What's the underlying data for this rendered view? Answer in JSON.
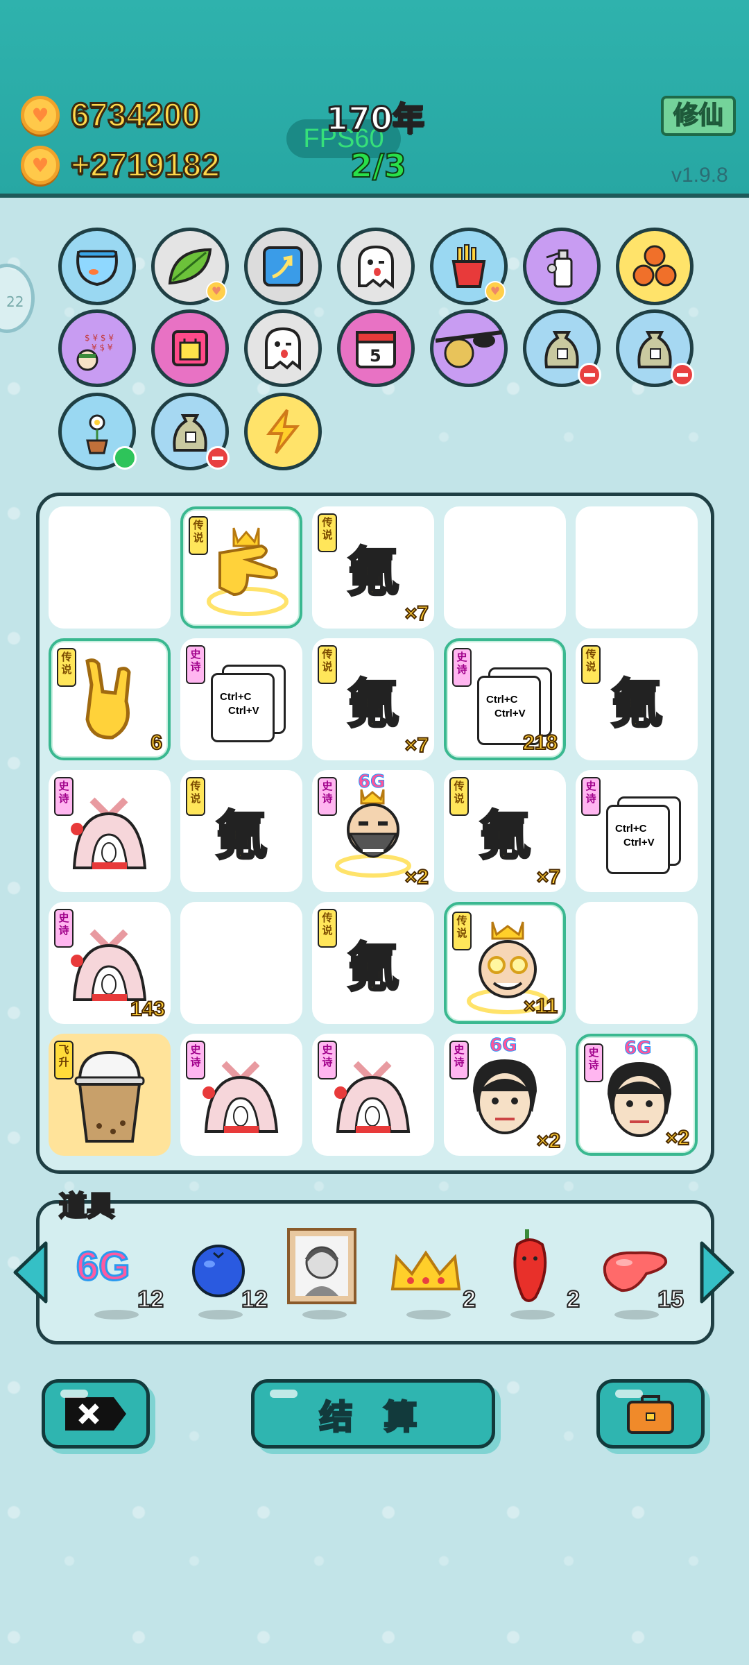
{
  "header": {
    "coins": "6734200",
    "income": "+2719182",
    "year": "170年",
    "fps": "FPS60",
    "counter": "2/3",
    "mode_button": "修仙",
    "version": "v1.9.8"
  },
  "side_tab": {
    "label": "22"
  },
  "skills": [
    {
      "name": "fishbowl-icon"
    },
    {
      "name": "leaf-icon"
    },
    {
      "name": "arrow-up-icon"
    },
    {
      "name": "ghost-icon"
    },
    {
      "name": "fries-icon"
    },
    {
      "name": "sprayer-icon"
    },
    {
      "name": "basketballs-icon"
    },
    {
      "name": "money-face-icon"
    },
    {
      "name": "bag-icon"
    },
    {
      "name": "ghost-icon-2"
    },
    {
      "name": "calendar-icon",
      "text": "5"
    },
    {
      "name": "sunglasses-icon"
    },
    {
      "name": "sack-icon"
    },
    {
      "name": "sack-icon-2"
    },
    {
      "name": "plant-icon"
    },
    {
      "name": "sack-icon-3"
    },
    {
      "name": "lightning-icon"
    }
  ],
  "board": {
    "cells": [
      {
        "empty": true
      },
      {
        "tag": "传说",
        "tag_type": "legend",
        "item": "hand-crown",
        "hl": true
      },
      {
        "tag": "传说",
        "tag_type": "legend",
        "item": "char",
        "char": "氪",
        "count": "×7"
      },
      {
        "empty": true
      },
      {
        "empty": true
      },
      {
        "tag": "传说",
        "tag_type": "legend",
        "item": "rock-hand",
        "count": "6",
        "hl": true
      },
      {
        "tag": "史诗",
        "tag_type": "epic",
        "item": "ctrl",
        "ctrl1": "Ctrl+C",
        "ctrl2": "Ctrl+V"
      },
      {
        "tag": "传说",
        "tag_type": "legend",
        "item": "char",
        "char": "氪",
        "count": "×7"
      },
      {
        "tag": "史诗",
        "tag_type": "epic",
        "item": "ctrl",
        "ctrl1": "Ctrl+C",
        "ctrl2": "Ctrl+V",
        "count": "218",
        "hl": true
      },
      {
        "tag": "传说",
        "tag_type": "legend",
        "item": "char",
        "char": "氪"
      },
      {
        "tag": "史诗",
        "tag_type": "epic",
        "item": "tent"
      },
      {
        "tag": "传说",
        "tag_type": "legend",
        "item": "char",
        "char": "氪"
      },
      {
        "tag": "史诗",
        "tag_type": "epic",
        "item": "bald-crown",
        "sixg": "6G",
        "count": "×2"
      },
      {
        "tag": "传说",
        "tag_type": "legend",
        "item": "char",
        "char": "氪",
        "count": "×7"
      },
      {
        "tag": "史诗",
        "tag_type": "epic",
        "item": "ctrl",
        "ctrl1": "Ctrl+C",
        "ctrl2": "Ctrl+V"
      },
      {
        "tag": "史诗",
        "tag_type": "epic",
        "item": "tent",
        "count": "143"
      },
      {
        "empty": true
      },
      {
        "tag": "传说",
        "tag_type": "legend",
        "item": "char",
        "char": "氪"
      },
      {
        "tag": "传说",
        "tag_type": "legend",
        "item": "king-face",
        "count": "×11",
        "hl": true
      },
      {
        "empty": true
      },
      {
        "tag": "飞升",
        "tag_type": "fly",
        "item": "cup",
        "gold": true
      },
      {
        "tag": "史诗",
        "tag_type": "epic",
        "item": "tent"
      },
      {
        "tag": "史诗",
        "tag_type": "epic",
        "item": "tent"
      },
      {
        "tag": "史诗",
        "tag_type": "epic",
        "item": "guy-face",
        "sixg": "6G",
        "count": "×2"
      },
      {
        "tag": "史诗",
        "tag_type": "epic",
        "item": "guy-face",
        "sixg": "6G",
        "count": "×2",
        "hl": true
      }
    ]
  },
  "items_bar": {
    "label": "道具",
    "items": [
      {
        "name": "6g-item",
        "text": "6G",
        "qty": "12"
      },
      {
        "name": "blueberry-item",
        "qty": "12"
      },
      {
        "name": "portrait-item",
        "qty": ""
      },
      {
        "name": "crown-item",
        "qty": "2"
      },
      {
        "name": "pepper-item",
        "qty": "2"
      },
      {
        "name": "liver-item",
        "qty": "15"
      }
    ]
  },
  "buttons": {
    "settle": "结 算"
  }
}
